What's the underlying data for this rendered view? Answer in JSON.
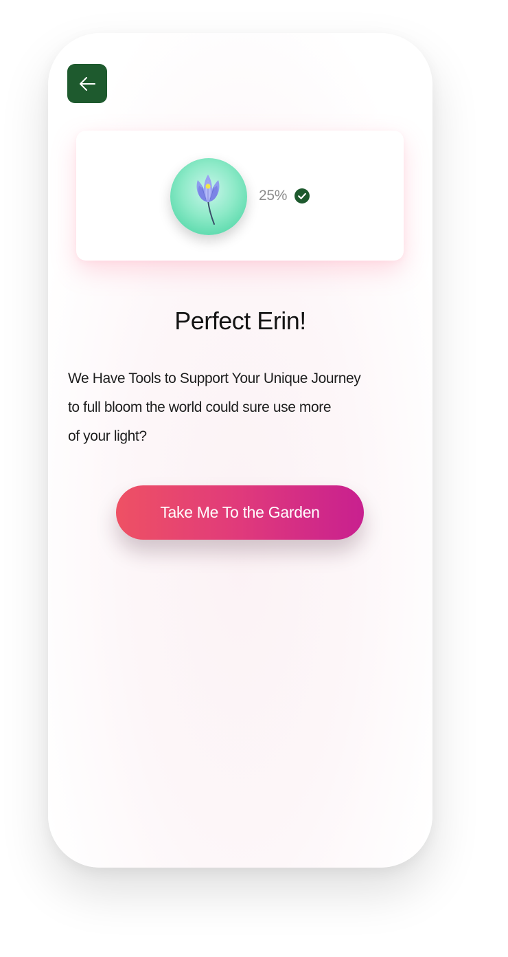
{
  "header": {
    "back_icon": "arrow-left-icon"
  },
  "progress_card": {
    "badge_icon": "lotus-flower-icon",
    "progress_label": "25%",
    "progress_fraction": 0.25,
    "status_icon": "check-circle-icon"
  },
  "content": {
    "title": "Perfect Erin!",
    "body_lines": [
      "We Have Tools to Support Your Unique Journey",
      "to full bloom the world could sure use more",
      "of your light?"
    ]
  },
  "cta": {
    "label": "Take Me To the Garden"
  },
  "colors": {
    "back_button": "#1e5a2e",
    "check": "#1e5a2e",
    "cta_start": "#ee5164",
    "cta_end": "#c8208f",
    "badge": "#62dcb0"
  }
}
